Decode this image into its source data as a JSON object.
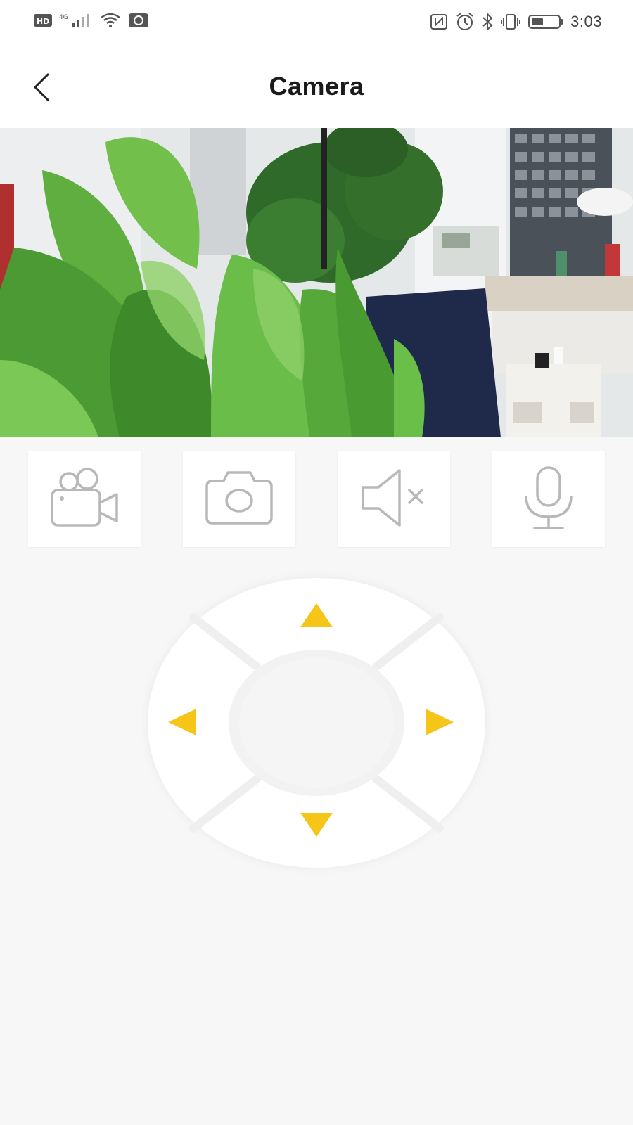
{
  "status_bar": {
    "time": "3:03",
    "left_icons": [
      "hd-icon",
      "signal-icon",
      "wifi-icon",
      "data-saver-icon"
    ],
    "right_icons": [
      "nfc-icon",
      "alarm-icon",
      "bluetooth-icon",
      "vibrate-icon",
      "battery-icon"
    ]
  },
  "header": {
    "title": "Camera",
    "back_icon": "chevron-left-icon"
  },
  "controls": {
    "buttons": [
      {
        "name": "record-video",
        "icon": "video-camera-icon"
      },
      {
        "name": "snapshot",
        "icon": "photo-camera-icon"
      },
      {
        "name": "mute",
        "icon": "speaker-muted-icon"
      },
      {
        "name": "talk",
        "icon": "microphone-icon"
      }
    ],
    "dpad": {
      "accent": "#f5c518",
      "directions": [
        "up",
        "left",
        "right",
        "down"
      ]
    }
  },
  "colors": {
    "background": "#f7f7f7",
    "surface": "#ffffff",
    "icon_gray": "#b8b8b8",
    "accent_yellow": "#f5c518"
  }
}
